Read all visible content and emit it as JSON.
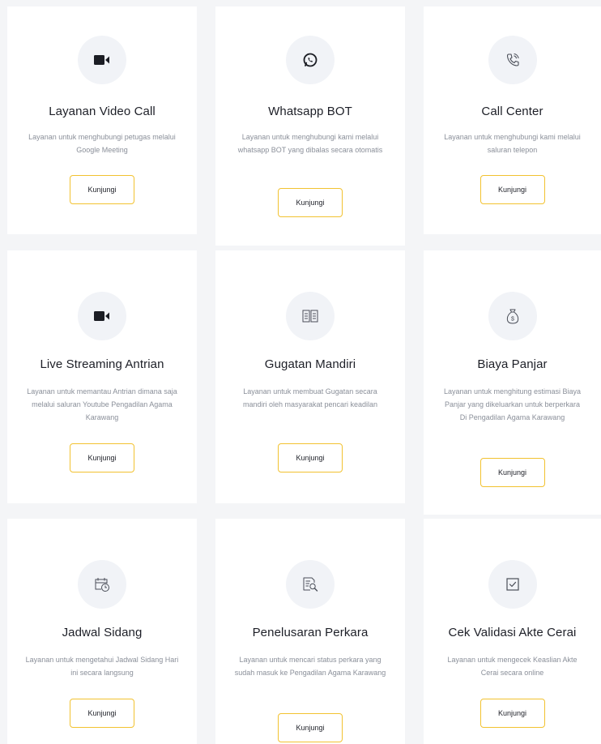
{
  "services": [
    {
      "icon": "video-camera-icon",
      "title": "Layanan Video Call",
      "desc": "Layanan untuk menghubungi petugas melalui Google Meeting",
      "button": "Kunjungi"
    },
    {
      "icon": "whatsapp-icon",
      "title": "Whatsapp BOT",
      "desc": "Layanan untuk menghubungi kami melalui whatsapp BOT yang dibalas secara otomatis",
      "button": "Kunjungi"
    },
    {
      "icon": "phone-call-icon",
      "title": "Call Center",
      "desc": "Layanan untuk menghubungi kami melalui saluran telepon",
      "button": "Kunjungi"
    },
    {
      "icon": "video-camera-icon",
      "title": "Live Streaming Antrian",
      "desc": "Layanan untuk memantau Antrian dimana saja melalui saluran Youtube Pengadilan Agama Karawang",
      "button": "Kunjungi"
    },
    {
      "icon": "document-columns-icon",
      "title": "Gugatan Mandiri",
      "desc": "Layanan untuk membuat Gugatan secara mandiri oleh masyarakat pencari keadilan",
      "button": "Kunjungi"
    },
    {
      "icon": "money-bag-icon",
      "title": "Biaya Panjar",
      "desc": "Layanan untuk menghitung estimasi Biaya Panjar yang dikeluarkan untuk berperkara Di Pengadilan Agama Karawang",
      "button": "Kunjungi"
    },
    {
      "icon": "calendar-clock-icon",
      "title": "Jadwal Sidang",
      "desc": "Layanan untuk mengetahui Jadwal Sidang Hari ini secara langsung",
      "button": "Kunjungi"
    },
    {
      "icon": "document-search-icon",
      "title": "Penelusaran Perkara",
      "desc": "Layanan untuk mencari status perkara yang sudah masuk ke Pengadilan Agama Karawang",
      "button": "Kunjungi"
    },
    {
      "icon": "checkbox-icon",
      "title": "Cek Validasi Akte Cerai",
      "desc": "Layanan untuk mengecek Keaslian Akte Cerai secara online",
      "button": "Kunjungi"
    }
  ]
}
